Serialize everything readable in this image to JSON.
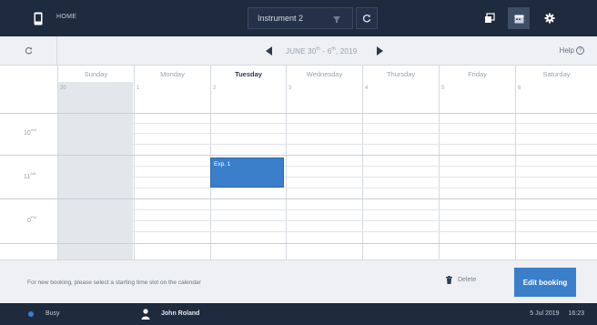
{
  "topbar": {
    "home_label": "HOME",
    "instrument": "Instrument 2",
    "icons": [
      "phone-icon",
      "caret-down-icon",
      "refresh-icon",
      "windows-icon",
      "calendar-icon",
      "gear-icon"
    ]
  },
  "nav": {
    "range_month": "JUNE 30",
    "range_sup1": "th",
    "range_mid": " - 6",
    "range_sup2": "th",
    "range_year": ", 2019",
    "help_label": "Help",
    "help_glyph": "?"
  },
  "calendar": {
    "days": [
      {
        "name": "Sunday",
        "num": "30"
      },
      {
        "name": "Monday",
        "num": "1"
      },
      {
        "name": "Tuesday",
        "num": "2"
      },
      {
        "name": "Wednesday",
        "num": "3"
      },
      {
        "name": "Thursday",
        "num": "4"
      },
      {
        "name": "Friday",
        "num": "5"
      },
      {
        "name": "Saturday",
        "num": "6"
      }
    ],
    "selected_day": "Tuesday",
    "times": [
      {
        "hour": "10",
        "suffix": "AM"
      },
      {
        "hour": "11",
        "suffix": "AM"
      },
      {
        "hour": "0",
        "suffix": "PM"
      }
    ],
    "event": {
      "label": "Exp. 1",
      "day": "Tuesday",
      "color": "#3b7fcb"
    }
  },
  "actions": {
    "hint": "For new booking, please select a starting time slot on the calendar",
    "delete_label": "Delete",
    "edit_label": "Edit booking"
  },
  "status": {
    "busy_label": "Busy",
    "user_name": "John Roland",
    "date": "5 Jul 2019",
    "time": "16:23"
  },
  "colors": {
    "topbar": "#1e2a3d",
    "accent": "#3b7fcb",
    "sunday_shade": "#e3e6ea"
  }
}
